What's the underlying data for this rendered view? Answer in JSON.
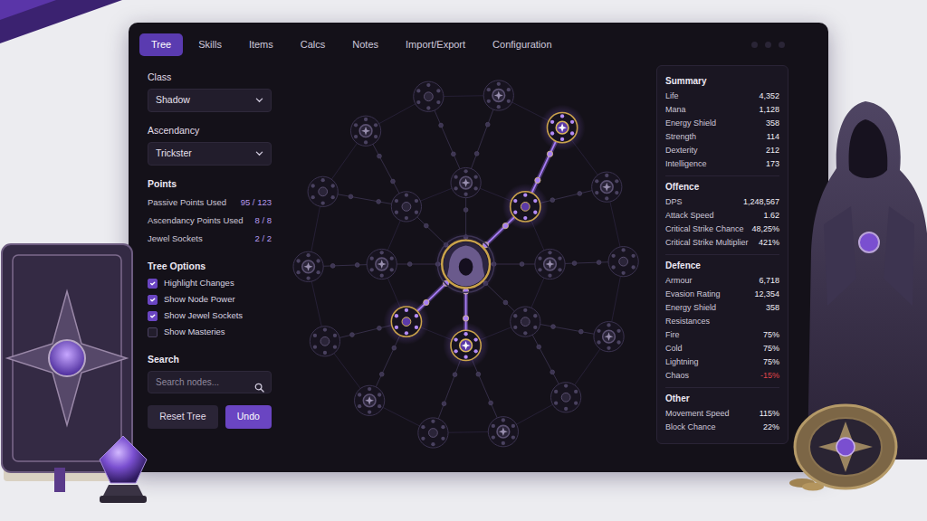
{
  "tabs": [
    {
      "label": "Tree",
      "selected": true
    },
    {
      "label": "Skills",
      "selected": false
    },
    {
      "label": "Items",
      "selected": false
    },
    {
      "label": "Calcs",
      "selected": false
    },
    {
      "label": "Notes",
      "selected": false
    },
    {
      "label": "Import/Export",
      "selected": false
    },
    {
      "label": "Configuration",
      "selected": false
    }
  ],
  "sidebar": {
    "class": {
      "label": "Class",
      "value": "Shadow"
    },
    "ascendancy": {
      "label": "Ascendancy",
      "value": "Trickster"
    },
    "points": {
      "title": "Points",
      "rows": [
        {
          "label": "Passive Points Used",
          "value": "95 / 123"
        },
        {
          "label": "Ascendancy Points Used",
          "value": "8 / 8"
        },
        {
          "label": "Jewel Sockets",
          "value": "2 / 2"
        }
      ]
    },
    "tree_options": {
      "title": "Tree Options",
      "items": [
        {
          "label": "Highlight Changes",
          "checked": true
        },
        {
          "label": "Show Node Power",
          "checked": true
        },
        {
          "label": "Show Jewel Sockets",
          "checked": true
        },
        {
          "label": "Show Masteries",
          "checked": false
        }
      ]
    },
    "search": {
      "title": "Search",
      "placeholder": "Search nodes..."
    },
    "buttons": [
      {
        "label": "Reset Tree",
        "primary": false
      },
      {
        "label": "Undo",
        "primary": true
      }
    ]
  },
  "tree": {
    "clusters": [
      {
        "allocated": false,
        "kind": "notable"
      },
      {
        "allocated": true,
        "kind": "small"
      },
      {
        "allocated": false,
        "kind": "notable"
      },
      {
        "allocated": false,
        "kind": "small"
      },
      {
        "allocated": true,
        "kind": "notable"
      },
      {
        "allocated": true,
        "kind": "small"
      },
      {
        "allocated": false,
        "kind": "notable"
      },
      {
        "allocated": false,
        "kind": "small"
      },
      {
        "allocated": false,
        "kind": "notable"
      },
      {
        "allocated": true,
        "kind": "notable"
      },
      {
        "allocated": false,
        "kind": "notable"
      },
      {
        "allocated": false,
        "kind": "small"
      },
      {
        "allocated": false,
        "kind": "notable"
      },
      {
        "allocated": false,
        "kind": "small"
      },
      {
        "allocated": false,
        "kind": "notable"
      },
      {
        "allocated": false,
        "kind": "small"
      },
      {
        "allocated": false,
        "kind": "notable"
      },
      {
        "allocated": false,
        "kind": "small"
      },
      {
        "allocated": false,
        "kind": "notable"
      },
      {
        "allocated": false,
        "kind": "small"
      },
      {
        "allocated": false,
        "kind": "notable"
      },
      {
        "allocated": false,
        "kind": "small"
      }
    ]
  },
  "stats": {
    "sections": [
      {
        "title": "Summary",
        "rows": [
          {
            "kind": "stat",
            "label": "Life",
            "value": "4,352",
            "negative": false
          },
          {
            "kind": "stat",
            "label": "Mana",
            "value": "1,128",
            "negative": false
          },
          {
            "kind": "stat",
            "label": "Energy Shield",
            "value": "358",
            "negative": false
          },
          {
            "kind": "stat",
            "label": "Strength",
            "value": "114",
            "negative": false
          },
          {
            "kind": "stat",
            "label": "Dexterity",
            "value": "212",
            "negative": false
          },
          {
            "kind": "stat",
            "label": "Intelligence",
            "value": "173",
            "negative": false
          }
        ]
      },
      {
        "title": "Offence",
        "rows": [
          {
            "kind": "stat",
            "label": "DPS",
            "value": "1,248,567",
            "negative": false
          },
          {
            "kind": "stat",
            "label": "Attack Speed",
            "value": "1.62",
            "negative": false
          },
          {
            "kind": "stat",
            "label": "Critical Strike Chance",
            "value": "48,25%",
            "negative": false
          },
          {
            "kind": "stat",
            "label": "Critical Strike Multiplier",
            "value": "421%",
            "negative": false
          }
        ]
      },
      {
        "title": "Defence",
        "rows": [
          {
            "kind": "stat",
            "label": "Armour",
            "value": "6,718",
            "negative": false
          },
          {
            "kind": "stat",
            "label": "Evasion Rating",
            "value": "12,354",
            "negative": false
          },
          {
            "kind": "stat",
            "label": "Energy Shield",
            "value": "358",
            "negative": false
          },
          {
            "kind": "subheader",
            "label": "Resistances"
          },
          {
            "kind": "stat",
            "label": "Fire",
            "value": "75%",
            "negative": false
          },
          {
            "kind": "stat",
            "label": "Cold",
            "value": "75%",
            "negative": false
          },
          {
            "kind": "stat",
            "label": "Lightning",
            "value": "75%",
            "negative": false
          },
          {
            "kind": "stat",
            "label": "Chaos",
            "value": "-15%",
            "negative": true
          }
        ]
      },
      {
        "title": "Other",
        "rows": [
          {
            "kind": "stat",
            "label": "Movement Speed",
            "value": "115%",
            "negative": false
          },
          {
            "kind": "stat",
            "label": "Block Chance",
            "value": "22%",
            "negative": false
          }
        ]
      }
    ]
  }
}
